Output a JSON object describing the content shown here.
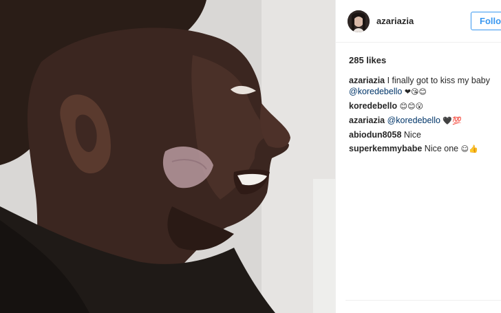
{
  "post": {
    "author": "azariazia",
    "follow_label": "Follow",
    "likes_text": "285 likes"
  },
  "comments": [
    {
      "user": "azariazia",
      "text": "I finally got to kiss my baby",
      "mention": "@koredebello",
      "emoji": "❤😘😊"
    },
    {
      "user": "koredebello",
      "text": "",
      "mention": "",
      "emoji": "😊😊😮"
    },
    {
      "user": "azariazia",
      "text": "",
      "mention": "@koredebello",
      "emoji": "🖤💯"
    },
    {
      "user": "abiodun8058",
      "text": "Nice",
      "mention": "",
      "emoji": ""
    },
    {
      "user": "superkemmybabe",
      "text": "Nice one",
      "mention": "",
      "emoji": "☺👍"
    }
  ],
  "colors": {
    "link": "#003569",
    "follow": "#3897f0"
  }
}
